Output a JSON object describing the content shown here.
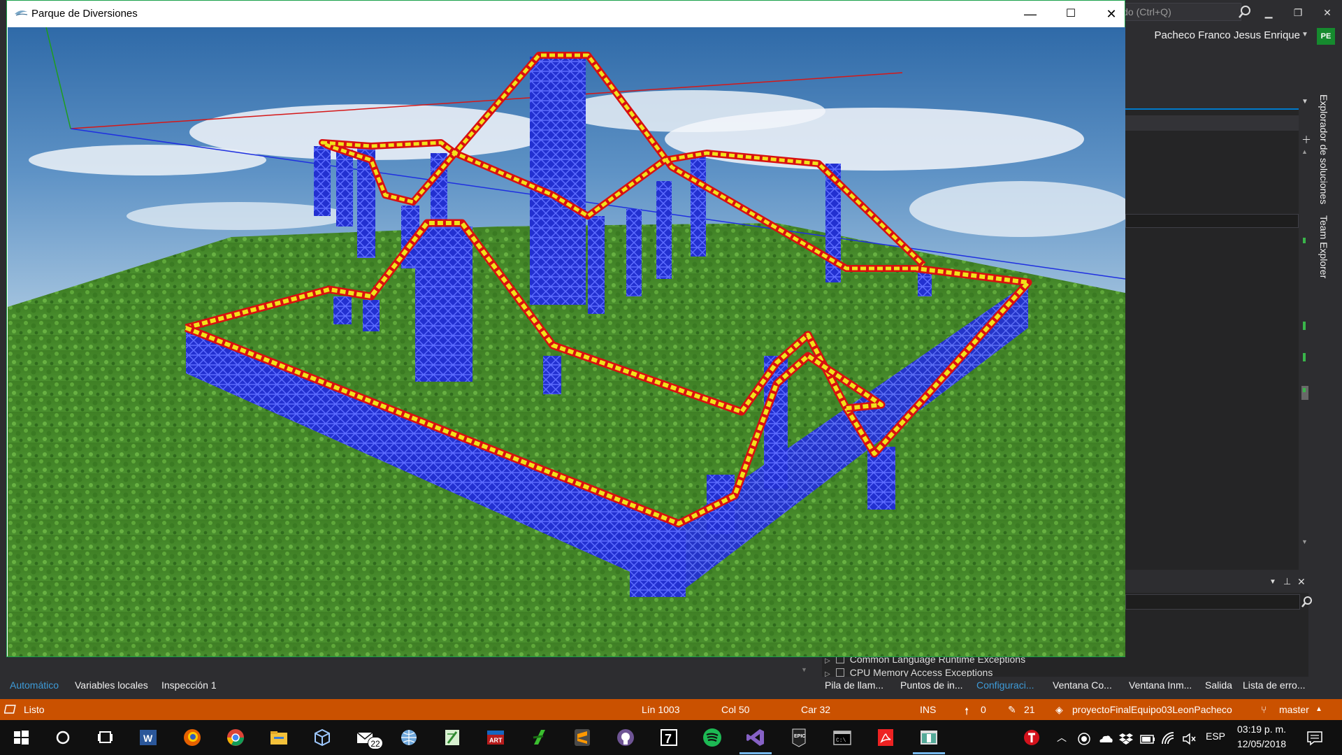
{
  "vs": {
    "search_placeholder": "ido (Ctrl+Q)",
    "user_name": "Pacheco Franco Jesus Enrique",
    "user_initials": "PE",
    "side_tabs": [
      "Explorador de soluciones",
      "Team Explorer"
    ],
    "exceptions": [
      "Common Language Runtime Exceptions",
      "CPU Memory Access Exceptions"
    ],
    "bottom_left_tabs": [
      "Automático",
      "Variables locales",
      "Inspección 1"
    ],
    "bottom_right_tabs": [
      "Pila de llam...",
      "Puntos de in...",
      "Configuraci...",
      "Ventana Co...",
      "Ventana Inm...",
      "Salida",
      "Lista de erro..."
    ],
    "status": {
      "ready": "Listo",
      "line": "Lín 1003",
      "col": "Col 50",
      "char": "Car 32",
      "mode": "INS",
      "up_count": "0",
      "pencil_count": "21",
      "repo": "proyectoFinalEquipo03LeonPacheco",
      "branch": "master"
    }
  },
  "gl_window": {
    "title": "Parque de Diversiones",
    "minimize": "—",
    "maximize": "☐",
    "close": "✕"
  },
  "taskbar": {
    "mail_badge": "22",
    "lang": "ESP",
    "time": "03:19 p. m.",
    "date": "12/05/2018",
    "icons": [
      "start-icon",
      "cortana-icon",
      "task-view-icon",
      "word-icon",
      "firefox-icon",
      "chrome-icon",
      "file-explorer-icon",
      "3d-icon",
      "mail-icon",
      "network-icon",
      "notepad-icon",
      "photos-icon",
      "green-app-icon",
      "sublime-icon",
      "github-icon",
      "seven-zip-icon",
      "spotify-icon",
      "visual-studio-icon",
      "epic-games-icon",
      "terminal-icon",
      "acrobat-icon",
      "opengl-app-icon"
    ]
  },
  "colors": {
    "vs_bg": "#2d2d30",
    "status_orange": "#ca5100",
    "accent_blue": "#007acc",
    "tower_blue": "#2230d0",
    "track_yellow": "#f2e21a",
    "track_red": "#d81010",
    "grass": "#4b8c2a"
  }
}
